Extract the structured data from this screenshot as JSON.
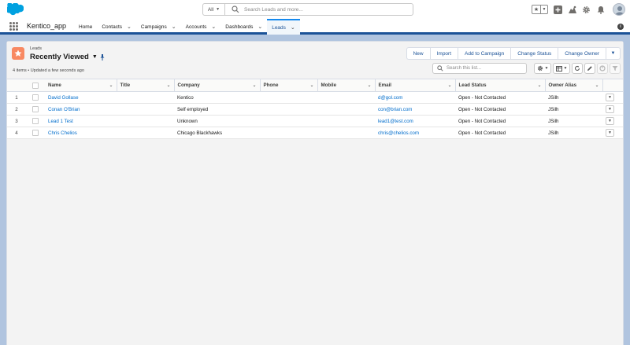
{
  "header": {
    "search_scope": "All",
    "search_placeholder": "Search Leads and more..."
  },
  "nav": {
    "app_name": "Kentico_app",
    "items": [
      {
        "label": "Home",
        "has_menu": false,
        "active": false
      },
      {
        "label": "Contacts",
        "has_menu": true,
        "active": false
      },
      {
        "label": "Campaigns",
        "has_menu": true,
        "active": false
      },
      {
        "label": "Accounts",
        "has_menu": true,
        "active": false
      },
      {
        "label": "Dashboards",
        "has_menu": true,
        "active": false
      },
      {
        "label": "Leads",
        "has_menu": true,
        "active": true
      }
    ]
  },
  "list": {
    "object_label": "Leads",
    "view_name": "Recently Viewed",
    "meta": "4 items • Updated a few seconds ago",
    "actions": [
      "New",
      "Import",
      "Add to Campaign",
      "Change Status",
      "Change Owner"
    ],
    "search_placeholder": "Search this list...",
    "columns": [
      "Name",
      "Title",
      "Company",
      "Phone",
      "Mobile",
      "Email",
      "Lead Status",
      "Owner Alias"
    ],
    "rows": [
      {
        "num": "1",
        "name": "David Gollase",
        "title": "",
        "company": "Kentico",
        "phone": "",
        "mobile": "",
        "email": "d@gol.com",
        "status": "Open - Not Contacted",
        "owner": "JSilh"
      },
      {
        "num": "2",
        "name": "Conan O'Brian",
        "title": "",
        "company": "Self employed",
        "phone": "",
        "mobile": "",
        "email": "con@brian.com",
        "status": "Open - Not Contacted",
        "owner": "JSilh"
      },
      {
        "num": "3",
        "name": "Lead 1 Test",
        "title": "",
        "company": "Unknown",
        "phone": "",
        "mobile": "",
        "email": "lead1@test.com",
        "status": "Open - Not Contacted",
        "owner": "JSilh"
      },
      {
        "num": "4",
        "name": "Chris Chelios",
        "title": "",
        "company": "Chicago Blackhawks",
        "phone": "",
        "mobile": "",
        "email": "chris@chelios.com",
        "status": "Open - Not Contacted",
        "owner": "JSilh"
      }
    ]
  },
  "colors": {
    "brand": "#1b5297",
    "link": "#006dcc",
    "lead_icon": "#f88962",
    "page_bg": "#b0c4df"
  }
}
